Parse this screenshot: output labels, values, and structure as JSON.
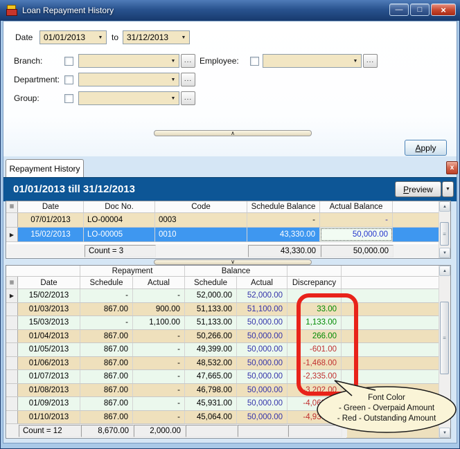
{
  "window": {
    "title": "Loan Repayment History"
  },
  "icons": {
    "minimize": "—",
    "restore": "□",
    "close": "×",
    "dropdown_arrow": "▼",
    "browse": "...",
    "collapse_up": "∧",
    "collapse_down": "∨",
    "current_row": "▶",
    "record_selector": "≡",
    "scroll_up": "▲",
    "scroll_down": "▼",
    "tab_close": "x"
  },
  "filters": {
    "date_label": "Date",
    "date_from": "01/01/2013",
    "to_label": "to",
    "date_to": "31/12/2013",
    "branch_label": "Branch:",
    "employee_label": "Employee:",
    "department_label": "Department:",
    "group_label": "Group:",
    "apply": {
      "accel": "A",
      "rest": "pply"
    }
  },
  "tab": {
    "label": "Repayment History"
  },
  "report_header": {
    "title": "01/01/2013 till 31/12/2013",
    "preview": {
      "accel": "P",
      "rest": "review"
    }
  },
  "loans_grid": {
    "columns": {
      "date": "Date",
      "doc_no": "Doc No.",
      "code": "Code",
      "schedule_balance": "Schedule Balance",
      "actual_balance": "Actual Balance"
    },
    "rows": [
      {
        "date": "07/01/2013",
        "doc_no": "LO-00004",
        "code": "0003",
        "schedule_balance": "-",
        "actual_balance": "-",
        "selected": "false"
      },
      {
        "date": "15/02/2013",
        "doc_no": "LO-00005",
        "code": "0010",
        "schedule_balance": "43,330.00",
        "actual_balance": "50,000.00",
        "selected": "true"
      }
    ],
    "footer": {
      "count": "Count = 3",
      "schedule_balance": "43,330.00",
      "actual_balance": "50,000.00"
    }
  },
  "schedule_grid": {
    "groups": {
      "repayment": "Repayment",
      "balance": "Balance"
    },
    "columns": {
      "date": "Date",
      "repayment_schedule": "Schedule",
      "repayment_actual": "Actual",
      "balance_schedule": "Schedule",
      "balance_actual": "Actual",
      "discrepancy": "Discrepancy"
    },
    "rows": [
      {
        "date": "15/02/2013",
        "repayment_schedule": "-",
        "repayment_actual": "-",
        "balance_schedule": "52,000.00",
        "balance_actual": "52,000.00",
        "discrepancy": "-",
        "disc_sign": "none",
        "current": "true"
      },
      {
        "date": "01/03/2013",
        "repayment_schedule": "867.00",
        "repayment_actual": "900.00",
        "balance_schedule": "51,133.00",
        "balance_actual": "51,100.00",
        "discrepancy": "33.00",
        "disc_sign": "overpaid",
        "current": "false"
      },
      {
        "date": "15/03/2013",
        "repayment_schedule": "-",
        "repayment_actual": "1,100.00",
        "balance_schedule": "51,133.00",
        "balance_actual": "50,000.00",
        "discrepancy": "1,133.00",
        "disc_sign": "overpaid",
        "current": "false"
      },
      {
        "date": "01/04/2013",
        "repayment_schedule": "867.00",
        "repayment_actual": "-",
        "balance_schedule": "50,266.00",
        "balance_actual": "50,000.00",
        "discrepancy": "266.00",
        "disc_sign": "overpaid",
        "current": "false"
      },
      {
        "date": "01/05/2013",
        "repayment_schedule": "867.00",
        "repayment_actual": "-",
        "balance_schedule": "49,399.00",
        "balance_actual": "50,000.00",
        "discrepancy": "-601.00",
        "disc_sign": "outstanding",
        "current": "false"
      },
      {
        "date": "01/06/2013",
        "repayment_schedule": "867.00",
        "repayment_actual": "-",
        "balance_schedule": "48,532.00",
        "balance_actual": "50,000.00",
        "discrepancy": "-1,468.00",
        "disc_sign": "outstanding",
        "current": "false"
      },
      {
        "date": "01/07/2013",
        "repayment_schedule": "867.00",
        "repayment_actual": "-",
        "balance_schedule": "47,665.00",
        "balance_actual": "50,000.00",
        "discrepancy": "-2,335.00",
        "disc_sign": "outstanding",
        "current": "false"
      },
      {
        "date": "01/08/2013",
        "repayment_schedule": "867.00",
        "repayment_actual": "-",
        "balance_schedule": "46,798.00",
        "balance_actual": "50,000.00",
        "discrepancy": "-3,202.00",
        "disc_sign": "outstanding",
        "current": "false"
      },
      {
        "date": "01/09/2013",
        "repayment_schedule": "867.00",
        "repayment_actual": "-",
        "balance_schedule": "45,931.00",
        "balance_actual": "50,000.00",
        "discrepancy": "-4,069.00",
        "disc_sign": "outstanding",
        "current": "false"
      },
      {
        "date": "01/10/2013",
        "repayment_schedule": "867.00",
        "repayment_actual": "-",
        "balance_schedule": "45,064.00",
        "balance_actual": "50,000.00",
        "discrepancy": "-4,936.00",
        "disc_sign": "outstanding",
        "current": "false"
      }
    ],
    "footer": {
      "count": "Count = 12",
      "repayment_schedule": "8,670.00",
      "repayment_actual": "2,000.00"
    }
  },
  "callout": {
    "line1": "Font Color",
    "line2": "- Green - Overpaid Amount",
    "line3": "- Red - Outstanding Amount"
  },
  "colors": {
    "overpaid_green": "#008A00",
    "outstanding_red": "#C03030",
    "balance_actual_blue": "#3333AA",
    "selected_row_blue": "#3E97F0",
    "annotation_red": "#E8231A",
    "report_band_blue": "#0D5696",
    "combo_cream": "#F2E6C3",
    "row_tan": "#EFE0BC",
    "row_mint": "#EBF8ED"
  }
}
